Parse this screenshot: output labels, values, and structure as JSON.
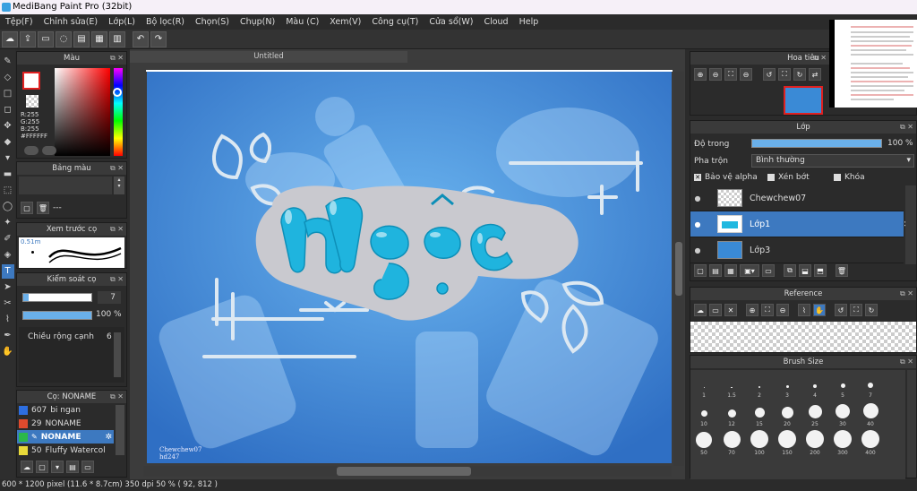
{
  "titlebar": {
    "title": "MediBang Paint Pro (32bit)"
  },
  "menu": [
    "Tệp(F)",
    "Chỉnh sửa(E)",
    "Lớp(L)",
    "Bộ lọc(R)",
    "Chọn(S)",
    "Chụp(N)",
    "Màu (C)",
    "Xem(V)",
    "Công cụ(T)",
    "Cửa sổ(W)",
    "Cloud",
    "Help"
  ],
  "color_panel": {
    "title": "Màu",
    "r": "R:255",
    "g": "G:255",
    "b": "B:255",
    "hex": "#FFFFFF"
  },
  "palette_panel": {
    "title": "Bảng màu",
    "empty_label": "---"
  },
  "brush_preview_panel": {
    "title": "Xem trước cọ",
    "size": "0.51m"
  },
  "brush_control_panel": {
    "title": "Kiểm soát cọ",
    "size_value": "7",
    "opacity_value": "100 %",
    "width_label": "Chiều rộng cạnh",
    "width_value": "6"
  },
  "brush_list_panel": {
    "title": "Cọ: NONAME",
    "items": [
      {
        "num": "607",
        "name": "bi ngan",
        "color": "#2d6ee0"
      },
      {
        "num": "29",
        "name": "NONAME",
        "color": "#e04a2d"
      },
      {
        "num": "",
        "name": "NONAME",
        "color": "#2bb84a"
      },
      {
        "num": "50",
        "name": "Fluffy Watercol",
        "color": "#e8d93a"
      }
    ]
  },
  "document": {
    "tab": "Untitled",
    "name_big": "Ngọc",
    "signature_1": "Chewchew07",
    "signature_2": "hd247"
  },
  "navigator_panel": {
    "title": "Hoa tiêu"
  },
  "layer_panel": {
    "title": "Lớp",
    "opacity_label": "Độ trong",
    "opacity_value": "100 %",
    "blend_label": "Pha trộn",
    "blend_value": "Bình thường",
    "protect_alpha": "Bảo vệ alpha",
    "clip": "Xén bớt",
    "lock": "Khóa",
    "layers": [
      {
        "name": "Chewchew07"
      },
      {
        "name": "Lớp1"
      },
      {
        "name": "Lớp3"
      }
    ]
  },
  "reference_panel": {
    "title": "Reference"
  },
  "brush_size_panel": {
    "title": "Brush Size",
    "sizes_row1": [
      "1",
      "1.5",
      "2",
      "3",
      "4",
      "5",
      "7"
    ],
    "sizes_row2": [
      "10",
      "12",
      "15",
      "20",
      "25",
      "30",
      "40"
    ],
    "sizes_row3": [
      "50",
      "70",
      "100",
      "150",
      "200",
      "300",
      "400"
    ]
  },
  "status": {
    "text": "600 * 1200 pixel   (11.6 * 8.7cm)   350 dpi   50 %   ( 92, 812 )"
  },
  "colors": {
    "accent": "#3d79c0",
    "canvas_blue": "#4a90d8",
    "text_teal": "#20b8e0"
  }
}
